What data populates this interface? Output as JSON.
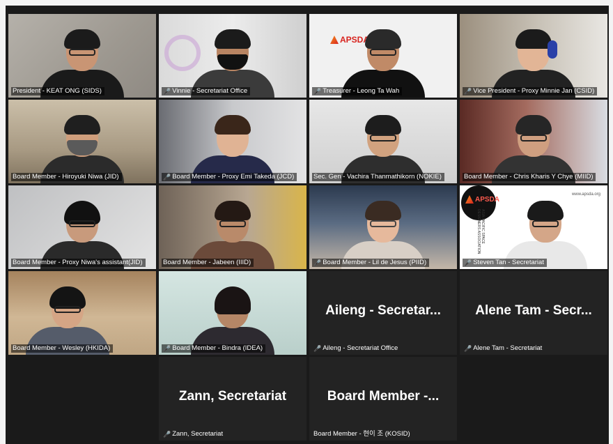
{
  "participants": [
    {
      "name": "President - KEAT ONG (SIDS)",
      "muted": false
    },
    {
      "name": "Vinnie - Secretariat Office",
      "muted": true
    },
    {
      "name": "Treasurer - Leong Ta Wah",
      "muted": true
    },
    {
      "name": "Vice President - Proxy Minnie Jan (CSID)",
      "muted": true
    },
    {
      "name": "Board Member - Hiroyuki Niwa (JID)",
      "muted": false
    },
    {
      "name": "Board Member - Proxy Emi Takeda (JCD)",
      "muted": true
    },
    {
      "name": "Sec. Gen - Vachira Thanmathikorn (NOKIE)",
      "muted": false,
      "speaking": true
    },
    {
      "name": "Board Member - Chris Kharis Y Chye (MIID)",
      "muted": false
    },
    {
      "name": "Board Member - Proxy Niwa's assistant(JID)",
      "muted": false
    },
    {
      "name": "Board Member - Jabeen (IIID)",
      "muted": false
    },
    {
      "name": "Board Member - Lil de Jesus (PIID)",
      "muted": true
    },
    {
      "name": "Steven Tan - Secretariat",
      "muted": true
    },
    {
      "name": "Board Member - Wesley (HKIDA)",
      "muted": false
    },
    {
      "name": "Board Member - Bindra (IDEA)",
      "muted": true
    },
    {
      "name": "Aileng - Secretariat Office",
      "muted": true,
      "display": "Aileng - Secretar..."
    },
    {
      "name": "Alene Tam - Secretariat",
      "muted": true,
      "display": "Alene Tam - Secr..."
    },
    {
      "name": "",
      "empty": true
    },
    {
      "name": "Zann, Secretariat",
      "muted": true,
      "display": "Zann, Secretariat"
    },
    {
      "name": "Board Member - 현이 조 (KOSID)",
      "muted": false,
      "display": "Board Member -..."
    },
    {
      "name": "",
      "empty": true
    }
  ],
  "logos": {
    "treasurer_logo": "APSDA",
    "steven_logo": "APSDA",
    "apsda_url": "www.apsda.org",
    "apsda_side": "ASIA PACIFIC SPACE DESIGNERS ASSOCIATION"
  },
  "colors": {
    "active_speaker": "#b7e04a",
    "mic_muted": "#ff4a4a",
    "tile_dark": "#232323"
  }
}
